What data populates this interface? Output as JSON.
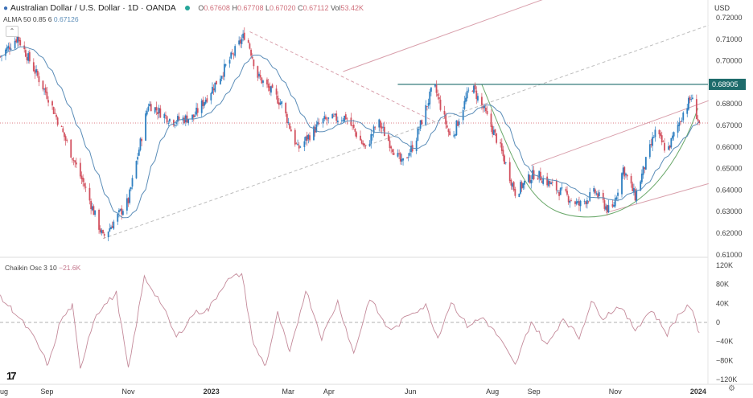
{
  "header": {
    "symbol": "Australian Dollar / U.S. Dollar · 1D · OANDA",
    "open_label": "O",
    "open": "0.67608",
    "high_label": "H",
    "high": "0.67708",
    "low_label": "L",
    "low": "0.67020",
    "close_label": "C",
    "close": "0.67112",
    "vol_label": "Vol",
    "vol": "53.42K"
  },
  "alma": {
    "label": "ALMA 50 0.85 6",
    "value": "0.67126"
  },
  "oscillator": {
    "label": "Chaikin Osc 3 10",
    "value": "−21.6K"
  },
  "currency": "USD",
  "colors": {
    "up": "#2f7fc1",
    "down": "#d2515f",
    "alma": "#5b8db8",
    "cup": "#6aa86a",
    "resistance": "#1e6b6b",
    "osc": "#c48a9a",
    "channel": "#d9a0ac",
    "trend": "#bdbdbd"
  },
  "chart_data": [
    {
      "type": "candlestick",
      "title": "Australian Dollar / U.S. Dollar · 1D · OANDA",
      "ylim": [
        0.61,
        0.72
      ],
      "y_ticks": [
        "0.72000",
        "0.71000",
        "0.70000",
        "0.69000",
        "0.68000",
        "0.67000",
        "0.66000",
        "0.65000",
        "0.64000",
        "0.63000",
        "0.62000",
        "0.61000"
      ],
      "x_ticks": [
        {
          "date": "2022-08-01",
          "label": "ug"
        },
        {
          "date": "2022-09-01",
          "label": "Sep"
        },
        {
          "date": "2022-11-01",
          "label": "Nov"
        },
        {
          "date": "2023-01-01",
          "label": "2023"
        },
        {
          "date": "2023-03-01",
          "label": "Mar"
        },
        {
          "date": "2023-04-01",
          "label": "Apr"
        },
        {
          "date": "2023-06-01",
          "label": "Jun"
        },
        {
          "date": "2023-08-01",
          "label": "Aug"
        },
        {
          "date": "2023-09-01",
          "label": "Sep"
        },
        {
          "date": "2023-11-01",
          "label": "Nov"
        },
        {
          "date": "2024-01-01",
          "label": "2024"
        }
      ],
      "close_path": [
        [
          "2022-07-28",
          0.702
        ],
        [
          "2022-08-10",
          0.711
        ],
        [
          "2022-09-02",
          0.683
        ],
        [
          "2022-09-29",
          0.642
        ],
        [
          "2022-10-13",
          0.618
        ],
        [
          "2022-11-01",
          0.635
        ],
        [
          "2022-11-16",
          0.68
        ],
        [
          "2022-12-04",
          0.672
        ],
        [
          "2022-12-20",
          0.674
        ],
        [
          "2023-01-07",
          0.691
        ],
        [
          "2023-01-28",
          0.713
        ],
        [
          "2023-02-06",
          0.693
        ],
        [
          "2023-02-24",
          0.68
        ],
        [
          "2023-03-08",
          0.659
        ],
        [
          "2023-03-26",
          0.672
        ],
        [
          "2023-04-13",
          0.674
        ],
        [
          "2023-04-28",
          0.659
        ],
        [
          "2023-05-07",
          0.672
        ],
        [
          "2023-05-25",
          0.652
        ],
        [
          "2023-06-03",
          0.661
        ],
        [
          "2023-06-18",
          0.689
        ],
        [
          "2023-07-01",
          0.663
        ],
        [
          "2023-07-16",
          0.689
        ],
        [
          "2023-07-25",
          0.678
        ],
        [
          "2023-08-06",
          0.661
        ],
        [
          "2023-08-18",
          0.639
        ],
        [
          "2023-09-02",
          0.648
        ],
        [
          "2023-09-17",
          0.641
        ],
        [
          "2023-10-05",
          0.633
        ],
        [
          "2023-10-17",
          0.639
        ],
        [
          "2023-10-29",
          0.629
        ],
        [
          "2023-11-07",
          0.65
        ],
        [
          "2023-11-16",
          0.637
        ],
        [
          "2023-12-01",
          0.667
        ],
        [
          "2023-12-10",
          0.658
        ],
        [
          "2023-12-22",
          0.676
        ],
        [
          "2023-12-28",
          0.683
        ],
        [
          "2024-01-03",
          0.671
        ]
      ],
      "last_price": 0.67112,
      "resistance": {
        "price": 0.68905,
        "label": "0.68905",
        "from": "2023-05-22"
      },
      "drawings": [
        {
          "kind": "dashed",
          "color": "channel",
          "from": [
            "2023-01-31",
            0.7135
          ],
          "to": [
            "2023-06-18",
            0.672
          ]
        },
        {
          "kind": "dashed",
          "color": "trend",
          "from": [
            "2022-10-13",
            0.6175
          ],
          "to": [
            "2024-01-10",
            0.7165
          ]
        },
        {
          "kind": "solid",
          "color": "channel",
          "from": [
            "2023-04-11",
            0.695
          ],
          "to": [
            "2023-09-17",
            0.7305
          ]
        },
        {
          "kind": "solid",
          "color": "channel",
          "from": [
            "2023-08-30",
            0.6515
          ],
          "to": [
            "2024-01-10",
            0.6815
          ]
        },
        {
          "kind": "solid",
          "color": "channel",
          "from": [
            "2023-10-25",
            0.6295
          ],
          "to": [
            "2024-01-10",
            0.643
          ]
        }
      ],
      "cup": {
        "start": [
          "2023-07-24",
          0.689
        ],
        "bottom": [
          "2023-10-12",
          0.6275
        ],
        "end": [
          "2024-01-02",
          0.678
        ]
      }
    },
    {
      "type": "line",
      "name": "Chaikin Osc 3 10",
      "ylim": [
        -120,
        120
      ],
      "y_unit": "K",
      "y_ticks": [
        "120K",
        "80K",
        "40K",
        "0",
        "−40K",
        "−80K",
        "−120K"
      ],
      "points": [
        [
          "2022-07-28",
          52
        ],
        [
          "2022-08-06",
          27
        ],
        [
          "2022-08-18",
          -15
        ],
        [
          "2022-08-24",
          -41
        ],
        [
          "2022-09-02",
          -91
        ],
        [
          "2022-09-11",
          2
        ],
        [
          "2022-09-20",
          35
        ],
        [
          "2022-09-26",
          -100
        ],
        [
          "2022-10-02",
          -32
        ],
        [
          "2022-10-08",
          19
        ],
        [
          "2022-10-23",
          61
        ],
        [
          "2022-11-01",
          -100
        ],
        [
          "2022-11-13",
          95
        ],
        [
          "2022-11-25",
          44
        ],
        [
          "2022-12-07",
          -32
        ],
        [
          "2022-12-20",
          19
        ],
        [
          "2022-12-31",
          27
        ],
        [
          "2023-01-13",
          86
        ],
        [
          "2023-01-25",
          103
        ],
        [
          "2023-02-03",
          -49
        ],
        [
          "2023-02-12",
          -91
        ],
        [
          "2023-02-21",
          19
        ],
        [
          "2023-03-02",
          -66
        ],
        [
          "2023-03-14",
          69
        ],
        [
          "2023-03-26",
          -32
        ],
        [
          "2023-04-07",
          44
        ],
        [
          "2023-04-19",
          -66
        ],
        [
          "2023-05-01",
          52
        ],
        [
          "2023-05-13",
          -7
        ],
        [
          "2023-05-19",
          -15
        ],
        [
          "2023-05-31",
          19
        ],
        [
          "2023-06-12",
          35
        ],
        [
          "2023-06-21",
          -32
        ],
        [
          "2023-07-01",
          44
        ],
        [
          "2023-07-13",
          -7
        ],
        [
          "2023-07-25",
          10
        ],
        [
          "2023-08-06",
          -32
        ],
        [
          "2023-08-18",
          -91
        ],
        [
          "2023-08-30",
          2
        ],
        [
          "2023-09-11",
          -49
        ],
        [
          "2023-09-23",
          10
        ],
        [
          "2023-10-05",
          -32
        ],
        [
          "2023-10-14",
          44
        ],
        [
          "2023-10-23",
          10
        ],
        [
          "2023-11-04",
          35
        ],
        [
          "2023-11-16",
          -15
        ],
        [
          "2023-11-28",
          27
        ],
        [
          "2023-12-10",
          -24
        ],
        [
          "2023-12-19",
          19
        ],
        [
          "2023-12-27",
          35
        ],
        [
          "2024-01-03",
          -21.6
        ]
      ]
    }
  ]
}
